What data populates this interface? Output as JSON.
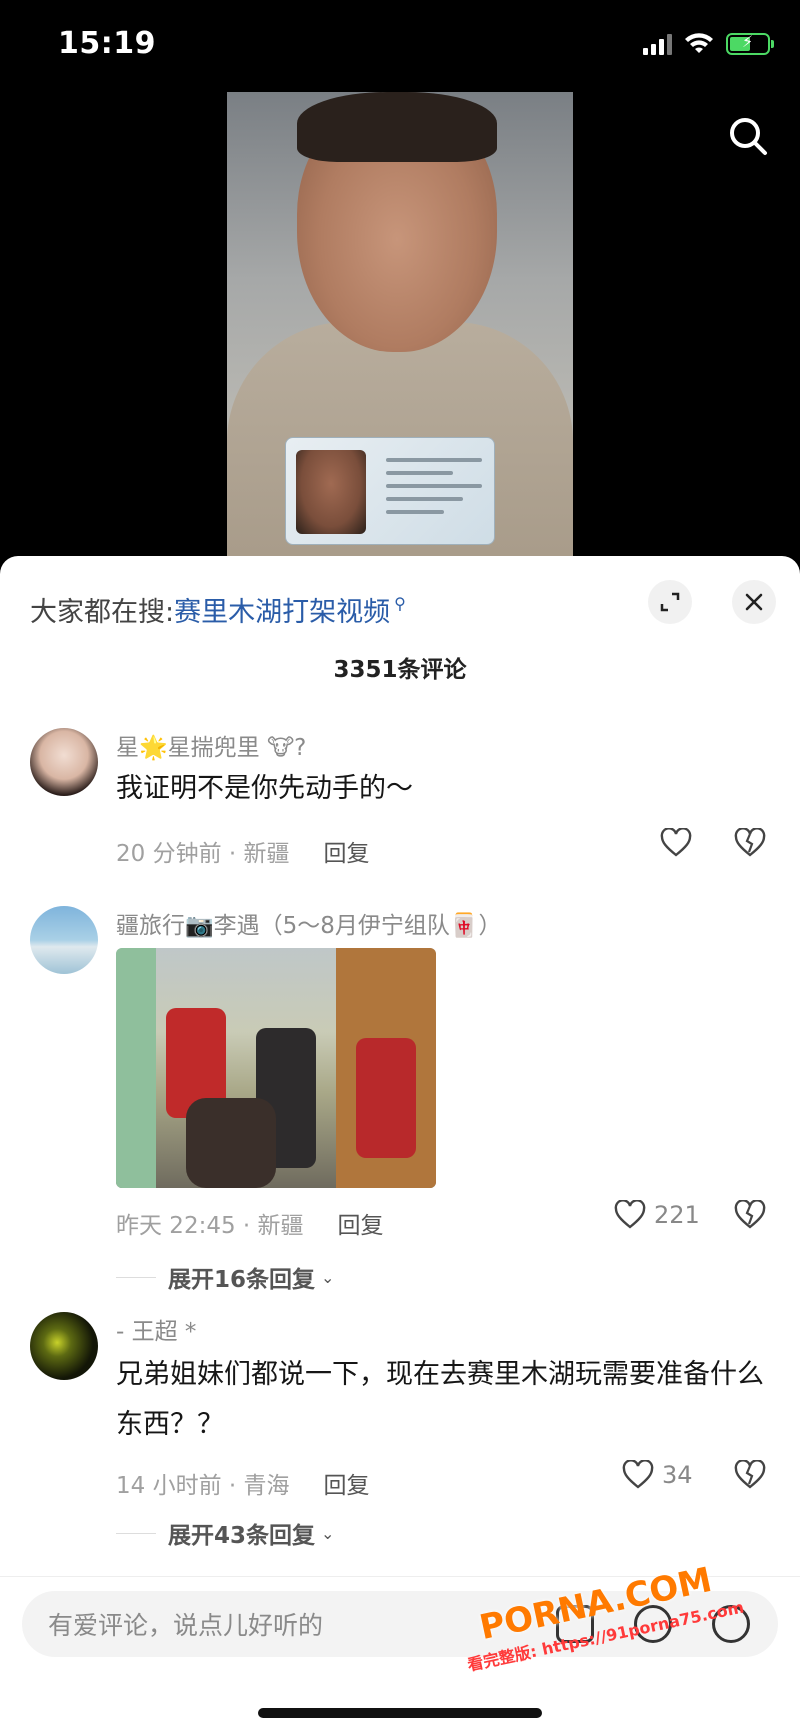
{
  "status_bar": {
    "time": "15:19"
  },
  "video": {
    "search_icon": "search-icon"
  },
  "sheet": {
    "hot_search_prefix": "大家都在搜:",
    "hot_search_keyword": "赛里木湖打架视频",
    "comment_count": "3351条评论"
  },
  "comments": [
    {
      "username": "星🌟星揣兜里 🐮?",
      "text": "我证明不是你先动手的～",
      "time_location": "20 分钟前 · 新疆",
      "reply_label": "回复",
      "likes": ""
    },
    {
      "username": "疆旅行📷李遇（5～8月伊宁组队🀄）",
      "text": "",
      "time_location": "昨天 22:45 · 新疆",
      "reply_label": "回复",
      "likes": "221",
      "expand_label": "展开16条回复"
    },
    {
      "username": "-    王超  *",
      "text": "兄弟姐妹们都说一下，现在去赛里木湖玩需要准备什么东西？？",
      "time_location": "14 小时前 · 青海",
      "reply_label": "回复",
      "likes": "34",
      "expand_label": "展开43条回复"
    }
  ],
  "input": {
    "placeholder": "有爱评论，说点儿好听的"
  },
  "watermark": {
    "brand": "PORNA.COM",
    "url_text": "看完整版: https://91porna75.com"
  }
}
